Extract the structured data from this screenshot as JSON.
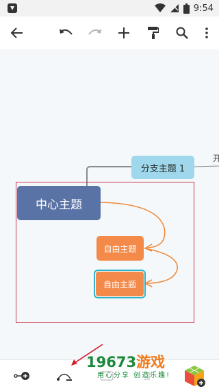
{
  "status_bar": {
    "time": "9:54"
  },
  "toolbar": {
    "back": "back-arrow",
    "undo": "undo",
    "redo": "redo",
    "add": "add",
    "format": "format-paint",
    "search": "search",
    "more": "more-vert"
  },
  "mindmap": {
    "central_topic": "中心主题",
    "branch_topic": "分支主题 1",
    "offscreen_label": "开",
    "free_topic_1": "自由主题",
    "free_topic_2": "自由主题"
  },
  "watermark": {
    "title_digits": "19673",
    "title_cn": "游戏",
    "subtitle": "用心分享  创造乐趣!"
  },
  "colors": {
    "central": "#5a73a6",
    "branch": "#9fd8ec",
    "free": "#f38a4a",
    "selection": "#c9354a",
    "connector": "#f08a3a"
  }
}
